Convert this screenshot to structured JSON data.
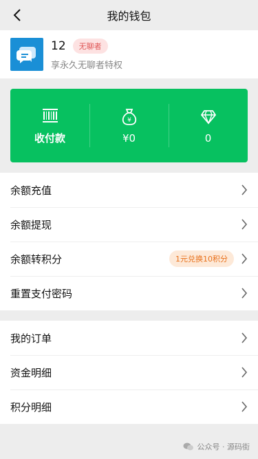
{
  "nav": {
    "title": "我的钱包"
  },
  "profile": {
    "name": "12",
    "badge": "无聊者",
    "subtitle": "享永久无聊者特权"
  },
  "wallet": {
    "pay_label": "收付款",
    "balance": "¥0",
    "points": "0"
  },
  "menu_group1": [
    {
      "label": "余额充值"
    },
    {
      "label": "余额提现"
    },
    {
      "label": "余额转积分",
      "tag": "1元兑换10积分"
    },
    {
      "label": "重置支付密码"
    }
  ],
  "menu_group2": [
    {
      "label": "我的订单"
    },
    {
      "label": "资金明细"
    },
    {
      "label": "积分明细"
    }
  ],
  "watermark": "公众号 · 源码街",
  "colors": {
    "brand_green": "#07c160",
    "badge_red": "#e05a5a",
    "tag_orange": "#e8701a",
    "avatar_blue": "#1a8fd6"
  },
  "icons": {
    "back": "chevron-left-icon",
    "pay": "barcode-icon",
    "balance": "money-bag-icon",
    "points": "diamond-icon",
    "row_arrow": "chevron-right-icon"
  }
}
